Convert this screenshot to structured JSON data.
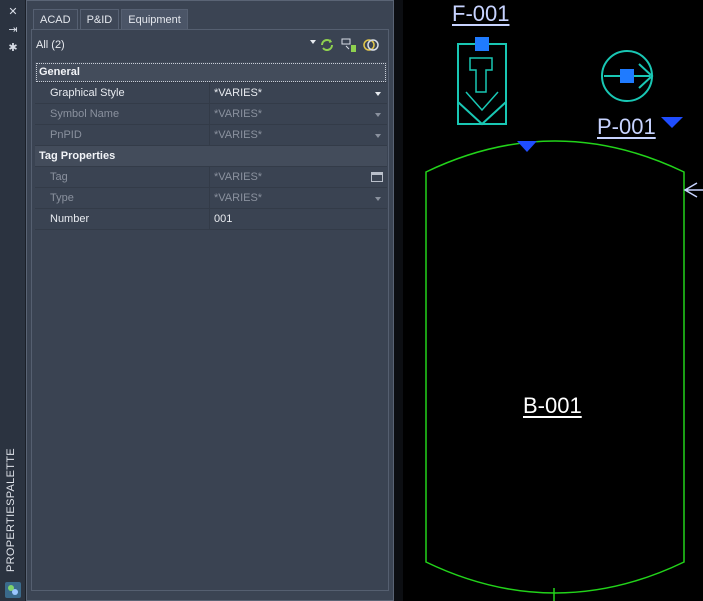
{
  "palette": {
    "strip_title": "PROPERTIESPALETTE",
    "tabs": [
      {
        "label": "ACAD"
      },
      {
        "label": "P&ID"
      },
      {
        "label": "Equipment",
        "active": true
      }
    ],
    "selection": {
      "value": "All (2)"
    },
    "sections": [
      {
        "title": "General",
        "rows": [
          {
            "label": "Graphical Style",
            "value": "*VARIES*",
            "enabled": true,
            "control": "dropdown"
          },
          {
            "label": "Symbol Name",
            "value": "*VARIES*",
            "enabled": false,
            "control": "dropdown"
          },
          {
            "label": "PnPID",
            "value": "*VARIES*",
            "enabled": false,
            "control": "dropdown"
          }
        ]
      },
      {
        "title": "Tag Properties",
        "rows": [
          {
            "label": "Tag",
            "value": "*VARIES*",
            "enabled": false,
            "control": "button"
          },
          {
            "label": "Type",
            "value": "*VARIES*",
            "enabled": false,
            "control": "dropdown"
          },
          {
            "label": "Number",
            "value": "001",
            "enabled": true,
            "control": "none"
          }
        ]
      }
    ]
  },
  "drawing": {
    "tags": {
      "filter": "F-001",
      "pump": "P-001",
      "vessel": "B-001"
    },
    "colors": {
      "vessel_outline": "#22d31a",
      "symbol_outline": "#19c7b4",
      "grip": "#1f7bff",
      "marker": "#1f4dff",
      "tag_text": "#c7d3ff"
    }
  },
  "icons": [
    "close-icon",
    "autohide-icon",
    "properties-icon",
    "quick-select-icon",
    "select-objects-icon",
    "toggle-pickadd-icon",
    "dropdown-arrow-icon",
    "browse-button-icon"
  ]
}
